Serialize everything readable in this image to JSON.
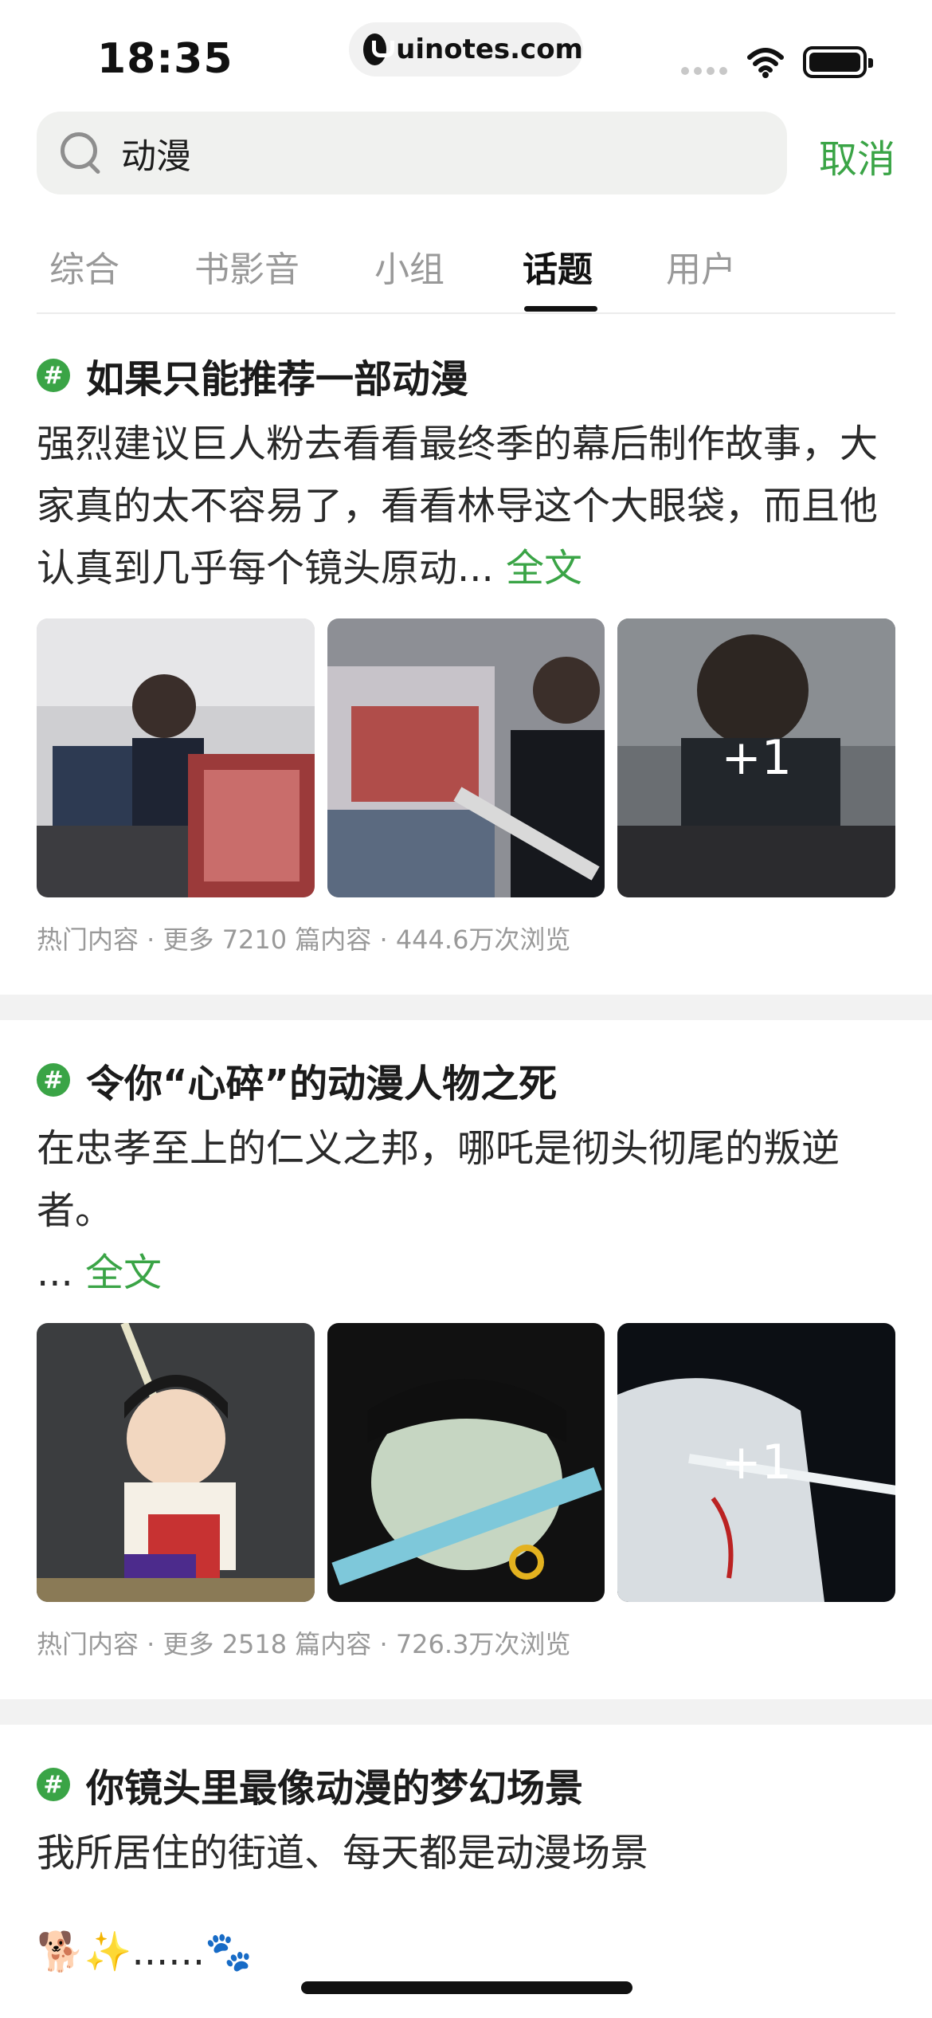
{
  "status_bar": {
    "time": "18:35",
    "url": "uinotes.com"
  },
  "search": {
    "query": "动漫",
    "cancel_label": "取消"
  },
  "tabs": [
    {
      "label": "综合"
    },
    {
      "label": "书影音"
    },
    {
      "label": "小组"
    },
    {
      "label": "话题",
      "active": true
    },
    {
      "label": "用户"
    }
  ],
  "topics": [
    {
      "hash": "#",
      "title": "如果只能推荐一部动漫",
      "body": "强烈建议巨人粉去看看最终季的幕后制作故事，大家真的太不容易了，看看林导这个大眼袋，而且他认真到几乎每个镜头原动...",
      "full_label": " 全文",
      "more_images": "+1",
      "meta": "热门内容 · 更多 7210 篇内容 · 444.6万次浏览"
    },
    {
      "hash": "#",
      "title": "令你“心碎”的动漫人物之死",
      "body": "在忠孝至上的仁义之邦，哪吒是彻头彻尾的叛逆者。",
      "body_tail": "...",
      "full_label": " 全文",
      "more_images": "+1",
      "meta": "热门内容 · 更多 2518 篇内容 · 726.3万次浏览"
    },
    {
      "hash": "#",
      "title": "你镜头里最像动漫的梦幻场景",
      "body": "我所居住的街道、每天都是动漫场景",
      "emoji_line": "🐕✨......🐾"
    }
  ]
}
